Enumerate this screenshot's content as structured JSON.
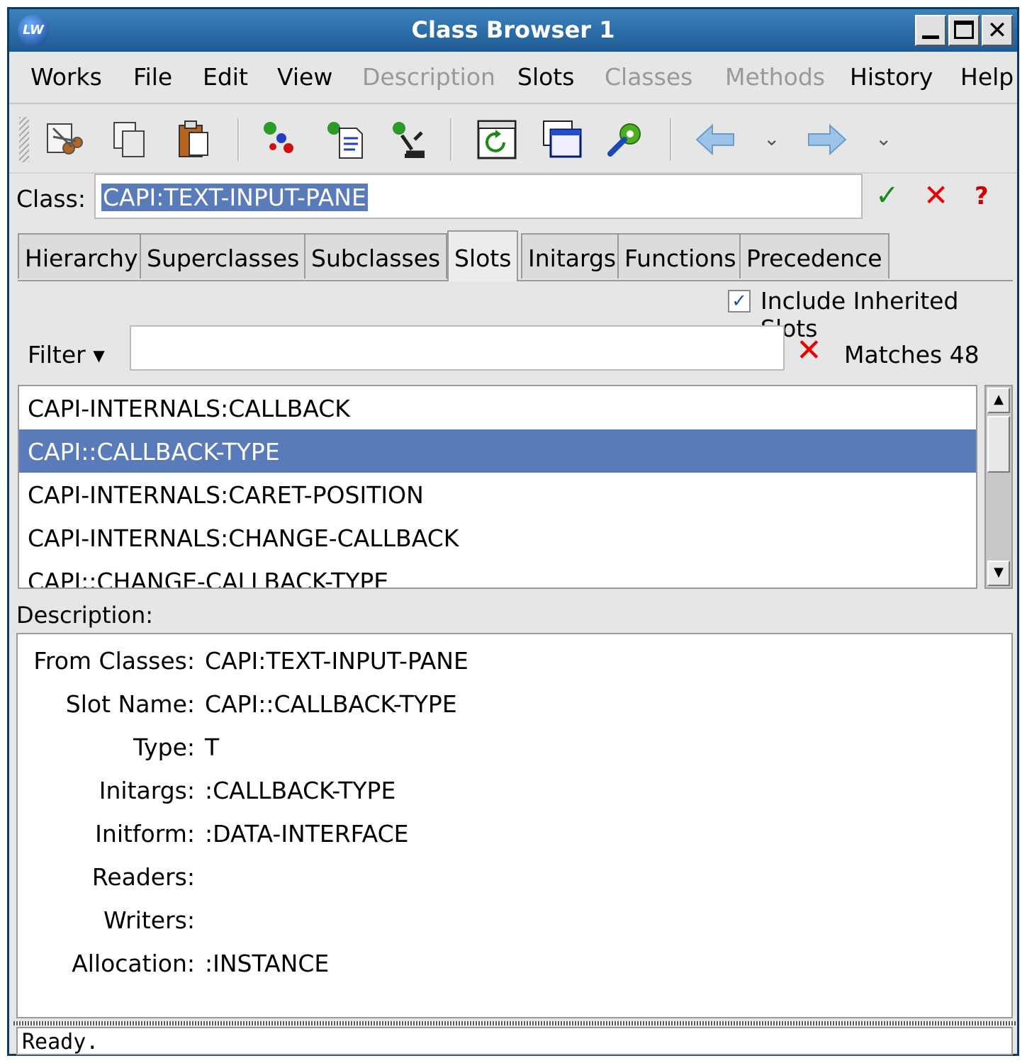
{
  "window": {
    "title": "Class Browser 1",
    "app_icon": "LW"
  },
  "menu": [
    {
      "label": "Works",
      "enabled": true
    },
    {
      "label": "File",
      "enabled": true
    },
    {
      "label": "Edit",
      "enabled": true
    },
    {
      "label": "View",
      "enabled": true
    },
    {
      "label": "Description",
      "enabled": false
    },
    {
      "label": "Slots",
      "enabled": true
    },
    {
      "label": "Classes",
      "enabled": false
    },
    {
      "label": "Methods",
      "enabled": false
    },
    {
      "label": "History",
      "enabled": true
    },
    {
      "label": "Help",
      "enabled": true
    }
  ],
  "toolbar": {
    "icons": [
      "cut-icon",
      "copy-icon",
      "paste-icon",
      "inspect-slots-icon",
      "describe-icon",
      "microscope-icon",
      "refresh-icon",
      "window-icon",
      "tools-icon",
      "back-icon",
      "forward-icon"
    ],
    "dropdown_glyph": "⌄"
  },
  "class_field": {
    "label": "Class:",
    "value": "CAPI:TEXT-INPUT-PANE",
    "ok_glyph": "✓",
    "cancel_glyph": "✕",
    "help_glyph": "?"
  },
  "tabs": [
    {
      "label": "Hierarchy",
      "active": false
    },
    {
      "label": "Superclasses",
      "active": false
    },
    {
      "label": "Subclasses",
      "active": false
    },
    {
      "label": "Slots",
      "active": true
    },
    {
      "label": "Initargs",
      "active": false
    },
    {
      "label": "Functions",
      "active": false
    },
    {
      "label": "Precedence",
      "active": false
    }
  ],
  "slots_panel": {
    "include_inherited_label": "Include Inherited Slots",
    "include_inherited_checked": true,
    "check_glyph": "✓",
    "filter_label": "Filter ▾",
    "filter_value": "",
    "clear_glyph": "✕",
    "matches_text": "Matches 48",
    "slots": [
      {
        "name": "CAPI-INTERNALS:CALLBACK",
        "selected": false
      },
      {
        "name": "CAPI::CALLBACK-TYPE",
        "selected": true
      },
      {
        "name": "CAPI-INTERNALS:CARET-POSITION",
        "selected": false
      },
      {
        "name": "CAPI-INTERNALS:CHANGE-CALLBACK",
        "selected": false
      },
      {
        "name": "CAPI::CHANGE-CALLBACK-TYPE",
        "selected": false
      }
    ],
    "scroll_up_glyph": "▲",
    "scroll_down_glyph": "▼"
  },
  "description": {
    "label": "Description:",
    "rows": [
      {
        "key": "From Classes:",
        "value": "CAPI:TEXT-INPUT-PANE"
      },
      {
        "key": "Slot Name:",
        "value": "CAPI::CALLBACK-TYPE"
      },
      {
        "key": "Type:",
        "value": "T"
      },
      {
        "key": "Initargs:",
        "value": ":CALLBACK-TYPE"
      },
      {
        "key": "Initform:",
        "value": ":DATA-INTERFACE"
      },
      {
        "key": "Readers:",
        "value": ""
      },
      {
        "key": "Writers:",
        "value": ""
      },
      {
        "key": "Allocation:",
        "value": ":INSTANCE"
      }
    ]
  },
  "status": {
    "text": "Ready."
  },
  "colors": {
    "selection": "#5a7bb9",
    "titlebar": "#2a6aa8",
    "accept": "#1a8a1a",
    "reject": "#e00000"
  }
}
